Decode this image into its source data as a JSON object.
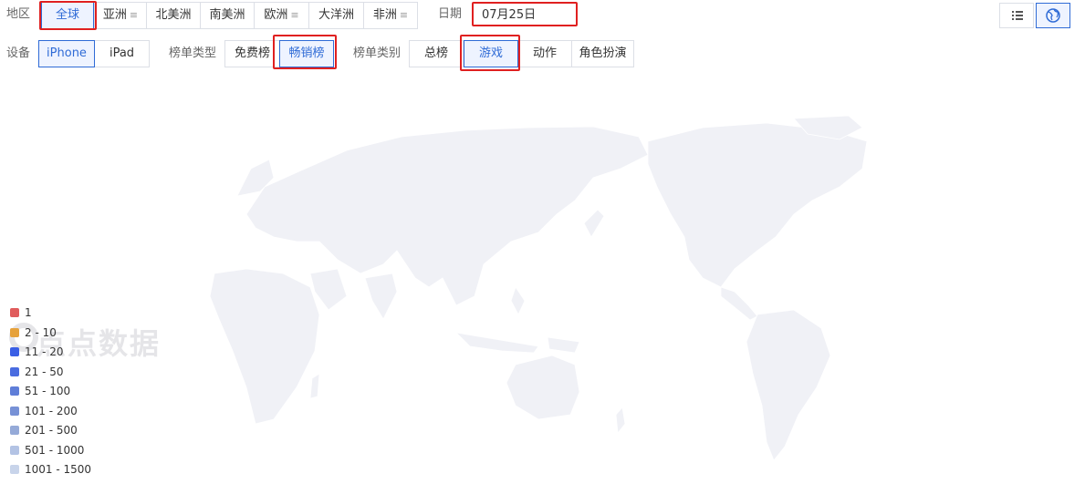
{
  "filters": {
    "region_label": "地区",
    "regions": [
      "全球",
      "亚洲",
      "北美洲",
      "南美洲",
      "欧洲",
      "大洋洲",
      "非洲"
    ],
    "region_selected": "全球",
    "date_label": "日期",
    "date_value": "07月25日",
    "device_label": "设备",
    "devices": [
      "iPhone",
      "iPad"
    ],
    "device_selected": "iPhone",
    "list_type_label": "榜单类型",
    "list_types": [
      "免费榜",
      "畅销榜"
    ],
    "list_type_selected": "畅销榜",
    "list_category_label": "榜单类别",
    "list_categories": [
      "总榜",
      "游戏",
      "动作",
      "角色扮演"
    ],
    "list_category_selected": "游戏"
  },
  "view_toggle": {
    "list_icon": "list-icon",
    "globe_icon": "globe-icon",
    "selected": "globe"
  },
  "watermark": "点点数据",
  "legend": [
    {
      "label": "1",
      "color": "#e05c5c"
    },
    {
      "label": "2 - 10",
      "color": "#e6a23c"
    },
    {
      "label": "11 - 20",
      "color": "#3a5fe5"
    },
    {
      "label": "21 - 50",
      "color": "#4a6ce0"
    },
    {
      "label": "51 - 100",
      "color": "#5f7ed8"
    },
    {
      "label": "101 - 200",
      "color": "#7791d6"
    },
    {
      "label": "201 - 500",
      "color": "#95aad8"
    },
    {
      "label": "501 - 1000",
      "color": "#b3c3e4"
    },
    {
      "label": "1001 - 1500",
      "color": "#c8d4ea"
    }
  ],
  "colors": {
    "accent": "#2f6bd6",
    "highlight": "#e02020",
    "land": "#f0f1f6"
  }
}
